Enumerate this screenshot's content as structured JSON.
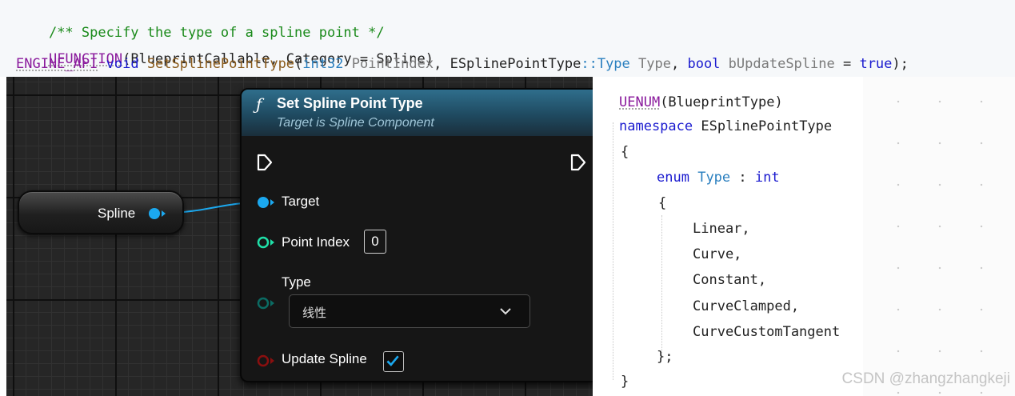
{
  "top_code": {
    "line1": {
      "comment": "/** Specify the type of a spline point */"
    },
    "line2": {
      "macro": "UFUNCTION",
      "args": "(BlueprintCallable, Category = Spline)"
    },
    "line3": {
      "api": "ENGINE_API",
      "ret": "void",
      "fname": "SetSplinePointType",
      "open": "(",
      "type1": "int32",
      "param1": "PointIndex",
      "sep1": ", ",
      "enum_ns": "ESplinePointType",
      "scope": "::",
      "enum_type": "Type",
      "param2": "Type",
      "sep2": ", ",
      "type3": "bool",
      "param3": "bUpdateSpline",
      "eq": " = ",
      "val": "true",
      "close": ");"
    }
  },
  "blueprint": {
    "spline_node": {
      "label": "Spline",
      "pin_color": "#1ba8ef"
    },
    "function_node": {
      "icon": "function-icon",
      "icon_glyph": "ƒ",
      "title": "Set Spline Point Type",
      "subtitle": "Target is Spline Component",
      "header_color": "#2f6e8c",
      "pins": {
        "target": "Target",
        "point_index": "Point Index",
        "point_index_value": "0",
        "type": "Type",
        "type_value": "线性",
        "update_spline": "Update Spline",
        "update_spline_checked": true
      },
      "pin_colors": {
        "object": "#1ba8ef",
        "int": "#1fe0a8",
        "byte": "#0b6b63",
        "bool": "#8a0f0f",
        "exec": "#ffffff"
      }
    }
  },
  "enum_code": {
    "macro": "UENUM",
    "macro_args": "(BlueprintType)",
    "ns_kw": "namespace",
    "ns_name": "ESplinePointType",
    "brace_open": "{",
    "enum_kw": "enum",
    "enum_name": "Type",
    "colon": " : ",
    "base": "int",
    "inner_brace_open": "{",
    "values": [
      "Linear,",
      "Curve,",
      "Constant,",
      "CurveClamped,",
      "CurveCustomTangent"
    ],
    "inner_brace_close": "};",
    "brace_close": "}"
  },
  "watermark": "CSDN @zhangzhangkeji"
}
